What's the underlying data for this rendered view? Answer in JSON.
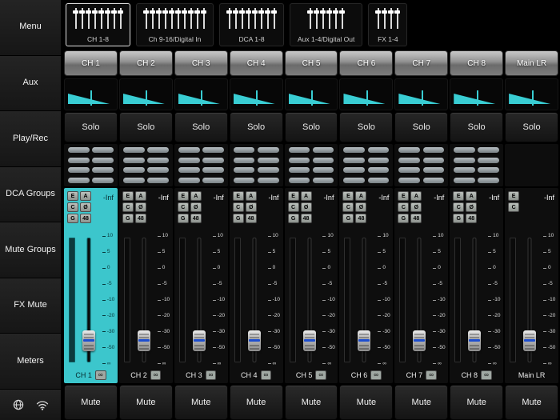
{
  "sidebar": {
    "items": [
      {
        "label": "Menu"
      },
      {
        "label": "Aux"
      },
      {
        "label": "Play/Rec"
      },
      {
        "label": "DCA Groups"
      },
      {
        "label": "Mute Groups"
      },
      {
        "label": "FX Mute"
      },
      {
        "label": "Meters"
      }
    ]
  },
  "bank_tabs": [
    {
      "label": "CH 1-8",
      "fader_icons": 8,
      "selected": true
    },
    {
      "label": "Ch 9-16/Digital In",
      "fader_icons": 10,
      "selected": false
    },
    {
      "label": "DCA 1-8",
      "fader_icons": 8,
      "selected": false
    },
    {
      "label": "Aux 1-4/Digital Out",
      "fader_icons": 6,
      "selected": false
    },
    {
      "label": "FX 1-4",
      "fader_icons": 4,
      "selected": false
    }
  ],
  "strip": {
    "solo_label": "Solo",
    "mute_label": "Mute",
    "link_label": "∞",
    "aux_send_rows": 4,
    "fader_scale": [
      "10",
      "5",
      "0",
      "-5",
      "-10",
      "-20",
      "-30",
      "-50",
      "∞"
    ]
  },
  "channels": [
    {
      "name": "CH 1",
      "level": "-Inf",
      "selected": true,
      "is_main": false,
      "proc_buttons": [
        "E",
        "A",
        "C",
        "Ø",
        "G",
        "48"
      ],
      "has_sends": true,
      "has_link": true,
      "fader_pos": 0.74
    },
    {
      "name": "CH 2",
      "level": "-Inf",
      "selected": false,
      "is_main": false,
      "proc_buttons": [
        "E",
        "A",
        "C",
        "Ø",
        "G",
        "48"
      ],
      "has_sends": true,
      "has_link": true,
      "fader_pos": 0.74
    },
    {
      "name": "CH 3",
      "level": "-Inf",
      "selected": false,
      "is_main": false,
      "proc_buttons": [
        "E",
        "A",
        "C",
        "Ø",
        "G",
        "48"
      ],
      "has_sends": true,
      "has_link": true,
      "fader_pos": 0.74
    },
    {
      "name": "CH 4",
      "level": "-Inf",
      "selected": false,
      "is_main": false,
      "proc_buttons": [
        "E",
        "A",
        "C",
        "Ø",
        "G",
        "48"
      ],
      "has_sends": true,
      "has_link": true,
      "fader_pos": 0.74
    },
    {
      "name": "CH 5",
      "level": "-Inf",
      "selected": false,
      "is_main": false,
      "proc_buttons": [
        "E",
        "A",
        "C",
        "Ø",
        "G",
        "48"
      ],
      "has_sends": true,
      "has_link": true,
      "fader_pos": 0.74
    },
    {
      "name": "CH 6",
      "level": "-Inf",
      "selected": false,
      "is_main": false,
      "proc_buttons": [
        "E",
        "A",
        "C",
        "Ø",
        "G",
        "48"
      ],
      "has_sends": true,
      "has_link": true,
      "fader_pos": 0.74
    },
    {
      "name": "CH 7",
      "level": "-Inf",
      "selected": false,
      "is_main": false,
      "proc_buttons": [
        "E",
        "A",
        "C",
        "Ø",
        "G",
        "48"
      ],
      "has_sends": true,
      "has_link": true,
      "fader_pos": 0.74
    },
    {
      "name": "CH 8",
      "level": "-Inf",
      "selected": false,
      "is_main": false,
      "proc_buttons": [
        "E",
        "A",
        "C",
        "Ø",
        "G",
        "48"
      ],
      "has_sends": true,
      "has_link": true,
      "fader_pos": 0.74
    },
    {
      "name": "Main LR",
      "level": "-Inf",
      "selected": false,
      "is_main": true,
      "proc_buttons": [
        "E",
        "C"
      ],
      "has_sends": false,
      "has_link": false,
      "fader_pos": 0.74
    }
  ],
  "colors": {
    "accent": "#39cdd3",
    "selected_strip": "#3cc6cc"
  }
}
